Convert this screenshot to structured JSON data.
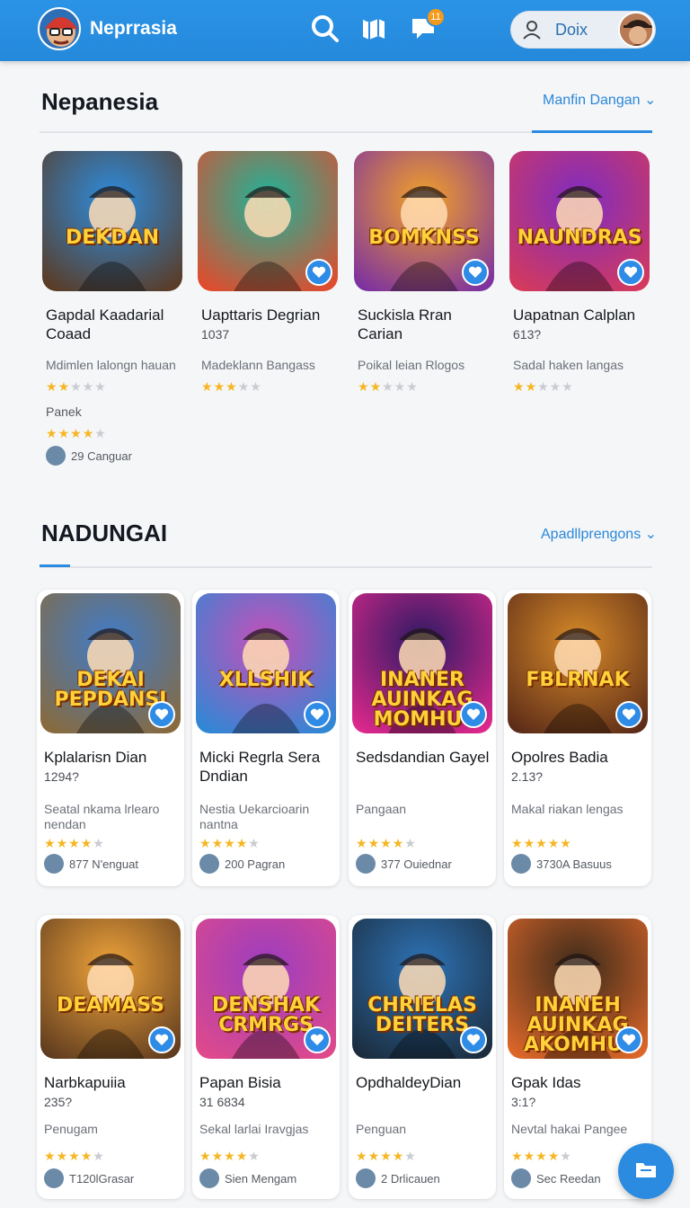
{
  "app": {
    "title": "Neprrasia",
    "notifications_count": "11",
    "user_name": "Doix"
  },
  "sections": [
    {
      "title": "Nepanesia",
      "link": "Manfin Dangan ⌄",
      "cards": [
        {
          "title": "Gapdal Kaadarial Coaad",
          "num": "",
          "desc": "Mdimlen lalongn hauan",
          "rating": 2,
          "extra": "Panek",
          "extra_rating": 4,
          "footer": "29 Canguar",
          "art": "DEKDAN",
          "colors": [
            "#2c8de0",
            "#5b3a22"
          ]
        },
        {
          "title": "Uapttaris Degrian",
          "num": "1037",
          "desc": "Madeklann Bangass",
          "rating": 3,
          "extra": "",
          "extra_rating": 0,
          "footer": "",
          "art": "",
          "colors": [
            "#1bb59a",
            "#e5492b"
          ]
        },
        {
          "title": "Suckisla Rran Carian",
          "num": "",
          "desc": "Poikal leian Rlogos",
          "rating": 2,
          "extra": "",
          "extra_rating": 0,
          "footer": "",
          "art": "BOMKNSS",
          "colors": [
            "#f3a227",
            "#7a2fa3"
          ]
        },
        {
          "title": "Uapatnan Calplan",
          "num": "613?",
          "desc": "Sadal haken langas",
          "rating": 2,
          "extra": "",
          "extra_rating": 0,
          "footer": "",
          "art": "NAUNDRAS",
          "colors": [
            "#7e2cc2",
            "#d63a5a"
          ]
        }
      ]
    },
    {
      "title": "NADUNGAI",
      "link": "Apadllprengons ⌄",
      "cards": [
        {
          "title": "Kplalarisn Dian",
          "num": "1294?",
          "desc": "Seatal nkama lrlearo nendan",
          "rating": 4,
          "footer": "877 N'enguat",
          "art": "DEKAI PEPDANSI",
          "colors": [
            "#3f7ccb",
            "#8a6a3a"
          ]
        },
        {
          "title": "Micki Regrla Sera Dndian",
          "num": "",
          "desc": "Nestia Uekarcioarin nantna",
          "rating": 4,
          "footer": "200 Pagran",
          "art": "XLLSHIK",
          "colors": [
            "#c64fb8",
            "#2c89d6"
          ]
        },
        {
          "title": "Sedsdandian Gayel",
          "num": "",
          "desc": "Pangaan",
          "rating": 4,
          "footer": "377 Ouiednar",
          "art": "INANER AUINKAG MOMHU!",
          "colors": [
            "#2b1a63",
            "#e0288c"
          ]
        },
        {
          "title": "Opolres Badia",
          "num": "2.13?",
          "desc": "Makal riakan lengas",
          "rating": 5,
          "footer": "3730A Basuus",
          "art": "FBLRNAK",
          "colors": [
            "#d78a28",
            "#5a2a18"
          ]
        },
        {
          "title": "Narbkapuiia",
          "num": "235?",
          "desc": "Penugam",
          "rating": 4,
          "footer": "T120lGrasar",
          "art": "DEAMASS",
          "colors": [
            "#f0a43a",
            "#5d3a1f"
          ]
        },
        {
          "title": "Papan Bisia",
          "num": "31 6834",
          "desc": "Sekal larlai Iravgjas",
          "rating": 4,
          "footer": "Sien Mengam",
          "art": "DENSHAK CRMRGS",
          "colors": [
            "#9b3dc0",
            "#e04a8a"
          ]
        },
        {
          "title": "OpdhaldeyDian",
          "num": "",
          "desc": "Penguan",
          "rating": 4,
          "footer": "2 Drlicauen",
          "art": "CHRIELAS DEITERS",
          "colors": [
            "#2e74b8",
            "#1b2b3b"
          ]
        },
        {
          "title": "Gpak Idas",
          "num": "3:1?",
          "desc": "Nevtal hakai Pangee",
          "rating": 4,
          "footer": "Sec Reedan",
          "art": "INANEH AUINKAG AKOMHU!",
          "colors": [
            "#3a2a1a",
            "#e0682a"
          ]
        }
      ]
    }
  ],
  "fab_icon": "folder-icon"
}
